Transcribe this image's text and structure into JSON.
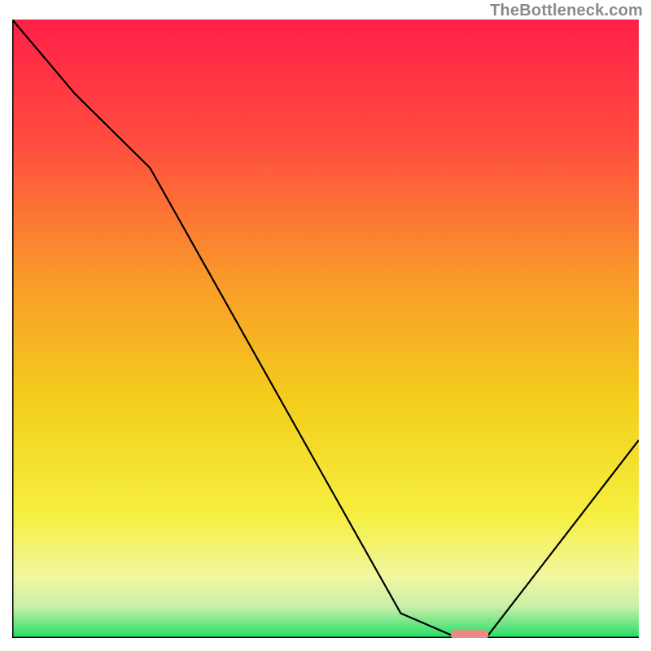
{
  "watermark": "TheBottleneck.com",
  "chart_data": {
    "type": "line",
    "title": "",
    "xlabel": "",
    "ylabel": "",
    "xlim": [
      0,
      100
    ],
    "ylim": [
      0,
      100
    ],
    "grid": false,
    "series": [
      {
        "name": "bottleneck-curve",
        "x": [
          0,
          10,
          22,
          62,
          70,
          76,
          100
        ],
        "y": [
          100,
          88,
          76,
          4,
          0.5,
          0.5,
          32
        ]
      }
    ],
    "marker": {
      "name": "optimal-region",
      "x_start": 70,
      "x_end": 76,
      "y": 0.5,
      "color": "#e98b82"
    },
    "background_gradient": {
      "stops": [
        {
          "pct": 0,
          "color": "#ff1f47"
        },
        {
          "pct": 20,
          "color": "#ff4d3f"
        },
        {
          "pct": 42,
          "color": "#f99a2a"
        },
        {
          "pct": 62,
          "color": "#f3cf1c"
        },
        {
          "pct": 80,
          "color": "#f6ef3f"
        },
        {
          "pct": 90,
          "color": "#f1f79f"
        },
        {
          "pct": 95,
          "color": "#c8efa8"
        },
        {
          "pct": 100,
          "color": "#20de65"
        }
      ]
    },
    "axis_color": "#000000",
    "line_color": "#000000",
    "line_width": 2.2
  }
}
